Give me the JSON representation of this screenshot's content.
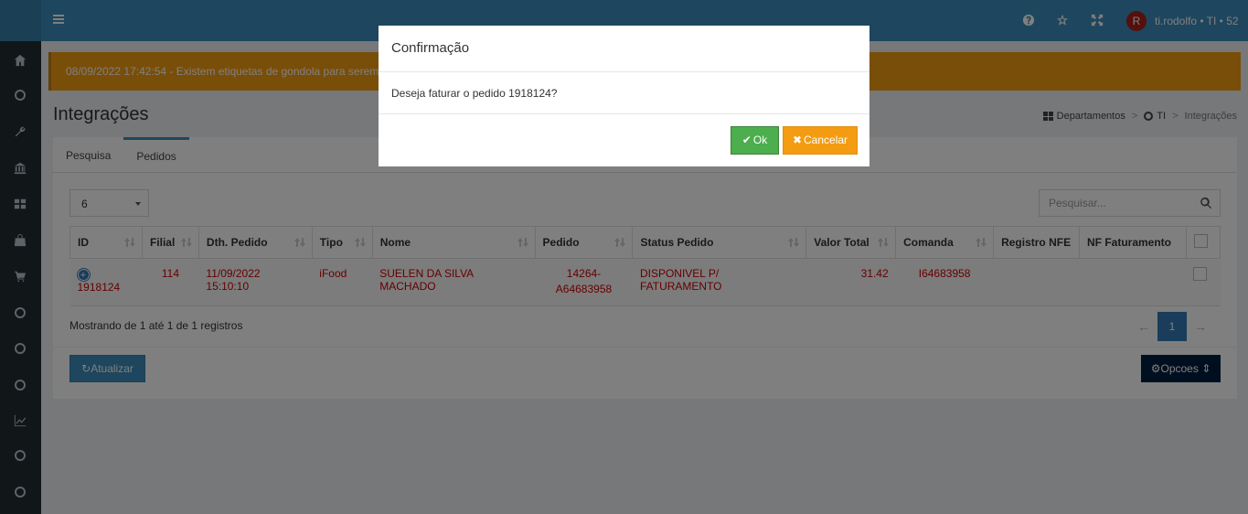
{
  "header": {
    "user_name": "ti.rodolfo • TI • 52",
    "avatar_letter": "R"
  },
  "alert": {
    "text": "08/09/2022 17:42:54 - Existem etiquetas de gondola para serem im"
  },
  "page": {
    "title": "Integrações"
  },
  "breadcrumb": {
    "items": [
      "Departamentos",
      "TI",
      "Integrações"
    ]
  },
  "tabs": [
    {
      "label": "Pesquisa"
    },
    {
      "label": "Pedidos"
    }
  ],
  "length_select": {
    "value": "6"
  },
  "search": {
    "placeholder": "Pesquisar..."
  },
  "table": {
    "columns": [
      "ID",
      "Filial",
      "Dth. Pedido",
      "Tipo",
      "Nome",
      "Pedido",
      "Status Pedido",
      "Valor Total",
      "Comanda",
      "Registro NFE",
      "NF Faturamento"
    ],
    "rows": [
      {
        "id": "1918124",
        "filial": "114",
        "dth": "11/09/2022 15:10:10",
        "tipo": "iFood",
        "nome": "SUELEN DA SILVA MACHADO",
        "pedido_l1": "14264-",
        "pedido_l2": "A64683958",
        "status": "DISPONIVEL P/ FATURAMENTO",
        "valor": "31.42",
        "comanda": "I64683958",
        "registro_nfe": "",
        "nf_faturamento": ""
      }
    ]
  },
  "footer": {
    "info": "Mostrando de 1 até 1 de 1 registros",
    "prev": "←",
    "page": "1",
    "next": "→"
  },
  "buttons": {
    "refresh": "Atualizar",
    "options": "Opcoes"
  },
  "modal": {
    "title": "Confirmação",
    "message": "Deseja faturar o pedido 1918124?",
    "ok_label": "Ok",
    "cancel_label": "Cancelar"
  },
  "colors": {
    "header": "#3c8dbc",
    "sidebar": "#222d32",
    "alert": "#f39c12",
    "row_text": "#cc0000",
    "ok": "#4cae4c",
    "cancel": "#f39c12",
    "options": "#001f3f"
  }
}
